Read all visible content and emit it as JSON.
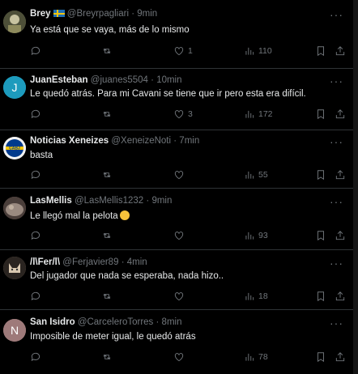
{
  "tweets": [
    {
      "name": "Brey",
      "handle": "@Breyrpagliari",
      "time": "9min",
      "text": "Ya está que se vaya, más de lo mismo",
      "likes": "1",
      "views": "110",
      "avatar": {
        "type": "photo",
        "color": "#6b6a4e"
      },
      "flag_icon": "sweden-flag-icon"
    },
    {
      "name": "JuanEsteban",
      "handle": "@juanes5504",
      "time": "10min",
      "text": "Le quedó atrás. Para mi Cavani se tiene que ir pero esta era difícil.",
      "likes": "3",
      "views": "172",
      "avatar": {
        "type": "letter",
        "letter": "J",
        "color": "#1d9bbd"
      }
    },
    {
      "name": "Noticias Xeneizes",
      "handle": "@XeneizeNoti",
      "time": "7min",
      "text": "basta",
      "likes": "",
      "views": "55",
      "avatar": {
        "type": "badge",
        "letters": "CABJ",
        "color": "#003a8c",
        "accent": "#f7c600"
      }
    },
    {
      "name": "LasMellis",
      "handle": "@LasMellis1232",
      "time": "9min",
      "text": "Le llegó mal la pelota",
      "emoji_icon": "face-emoji-icon",
      "likes": "",
      "views": "93",
      "avatar": {
        "type": "photo",
        "color": "#6e5a50"
      }
    },
    {
      "name": "/l\\Fer/l\\",
      "handle": "@Ferjavier89",
      "time": "4min",
      "text": "Del jugador que nada se esperaba, nada hizo..",
      "likes": "",
      "views": "18",
      "avatar": {
        "type": "photo",
        "color": "#8a7a66"
      }
    },
    {
      "name": "San Isidro",
      "handle": "@CarceleroTorres",
      "time": "8min",
      "text": "Imposible de meter igual, le quedó atrás",
      "likes": "",
      "views": "78",
      "avatar": {
        "type": "letter",
        "letter": "N",
        "color": "#8c6b6b"
      }
    }
  ],
  "dot": "·",
  "more": "···",
  "colors": {
    "background": "#000000",
    "text": "#e7e9ea",
    "muted": "#71767b",
    "divider": "#2f3336"
  }
}
